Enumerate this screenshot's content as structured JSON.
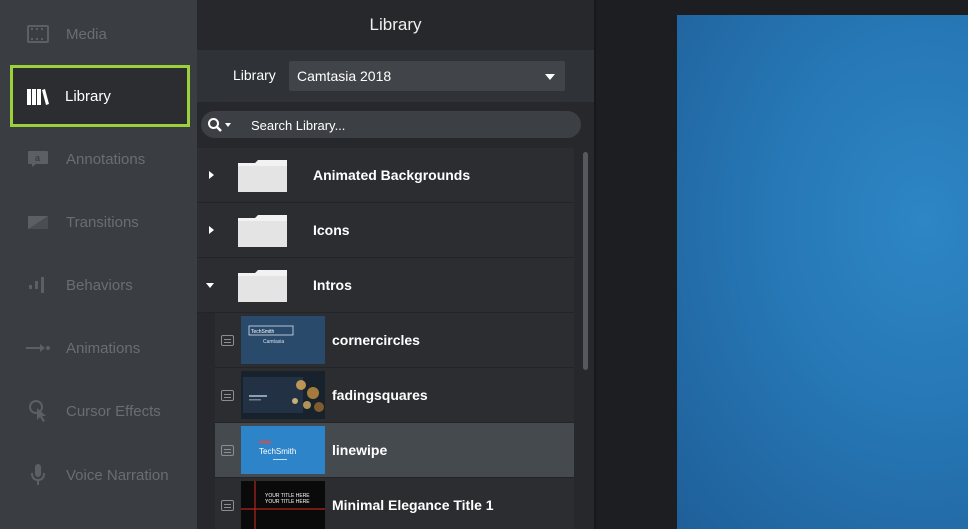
{
  "sidebar": {
    "items": [
      {
        "label": "Media",
        "icon": "film-icon"
      },
      {
        "label": "Library",
        "icon": "books-icon",
        "active": true
      },
      {
        "label": "Annotations",
        "icon": "annotation-icon"
      },
      {
        "label": "Transitions",
        "icon": "transition-icon"
      },
      {
        "label": "Behaviors",
        "icon": "behaviors-icon"
      },
      {
        "label": "Animations",
        "icon": "animation-arrow-icon"
      },
      {
        "label": "Cursor Effects",
        "icon": "cursor-icon"
      },
      {
        "label": "Voice Narration",
        "icon": "microphone-icon"
      }
    ],
    "accent_color": "#9dd13a"
  },
  "library": {
    "title": "Library",
    "selector_label": "Library",
    "selected": "Camtasia 2018",
    "search_placeholder": "Search Library...",
    "folders": [
      {
        "name": "Animated Backgrounds",
        "expanded": false
      },
      {
        "name": "Icons",
        "expanded": false
      },
      {
        "name": "Intros",
        "expanded": true
      }
    ],
    "assets": [
      {
        "name": "cornercircles",
        "thumb_line1": "TechSmith",
        "thumb_line2": "Camtasia"
      },
      {
        "name": "fadingsquares"
      },
      {
        "name": "linewipe",
        "thumb_text": "TechSmith",
        "selected": true
      },
      {
        "name": "Minimal Elegance Title 1",
        "thumb_line1": "YOUR TITLE HERE",
        "thumb_line2": "YOUR TITLE HERE"
      }
    ]
  },
  "colors": {
    "canvas_blue": "#2677b5",
    "selected_row": "#454a4e"
  }
}
